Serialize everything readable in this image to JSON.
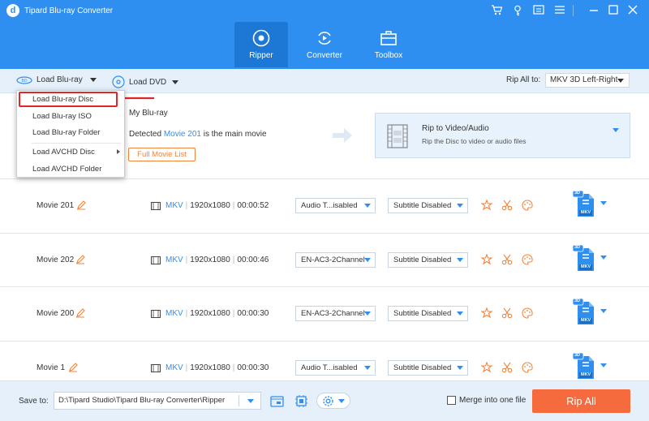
{
  "app": {
    "title": "Tipard Blu-ray Converter",
    "logo_letter": "d"
  },
  "tabs": [
    {
      "label": "Ripper",
      "active": true
    },
    {
      "label": "Converter",
      "active": false
    },
    {
      "label": "Toolbox",
      "active": false
    }
  ],
  "toolbar": {
    "load_bluray": "Load Blu-ray",
    "load_dvd": "Load DVD",
    "rip_all_to_label": "Rip All to:",
    "rip_all_to_value": "MKV 3D Left-Right"
  },
  "dropdown": {
    "items": [
      "Load Blu-ray Disc",
      "Load Blu-ray ISO",
      "Load Blu-ray Folder",
      "Load AVCHD Disc",
      "Load AVCHD Folder"
    ],
    "highlighted": "Load Blu-ray Disc"
  },
  "source": {
    "disc_label": "My Blu-ray",
    "detected_prefix": "Detected",
    "detected_movie": "Movie 201",
    "detected_suffix": "is the main movie",
    "full_list_button": "Full Movie List"
  },
  "rip_panel": {
    "title": "Rip to Video/Audio",
    "subtitle": "Rip the Disc to video or audio files"
  },
  "movies": [
    {
      "title": "Movie 201",
      "format": "MKV",
      "resolution": "1920x1080",
      "duration": "00:00:52",
      "audio": "Audio T...isabled",
      "subtitle": "Subtitle Disabled"
    },
    {
      "title": "Movie 202",
      "format": "MKV",
      "resolution": "1920x1080",
      "duration": "00:00:46",
      "audio": "EN-AC3-2Channel",
      "subtitle": "Subtitle Disabled"
    },
    {
      "title": "Movie 200",
      "format": "MKV",
      "resolution": "1920x1080",
      "duration": "00:00:30",
      "audio": "EN-AC3-2Channel",
      "subtitle": "Subtitle Disabled"
    },
    {
      "title": "Movie 1",
      "format": "MKV",
      "resolution": "1920x1080",
      "duration": "00:00:30",
      "audio": "Audio T...isabled",
      "subtitle": "Subtitle Disabled"
    }
  ],
  "output_format_badge": {
    "top": "3D",
    "bottom": "MKV"
  },
  "bottom": {
    "save_to_label": "Save to:",
    "save_path": "D:\\Tipard Studio\\Tipard Blu-ray Converter\\Ripper",
    "merge_label": "Merge into one file",
    "merge_checked": false,
    "rip_all_button": "Rip All"
  },
  "colors": {
    "accent": "#2f8ff0",
    "orange": "#f56b3e",
    "highlight_red": "#e0262b"
  }
}
